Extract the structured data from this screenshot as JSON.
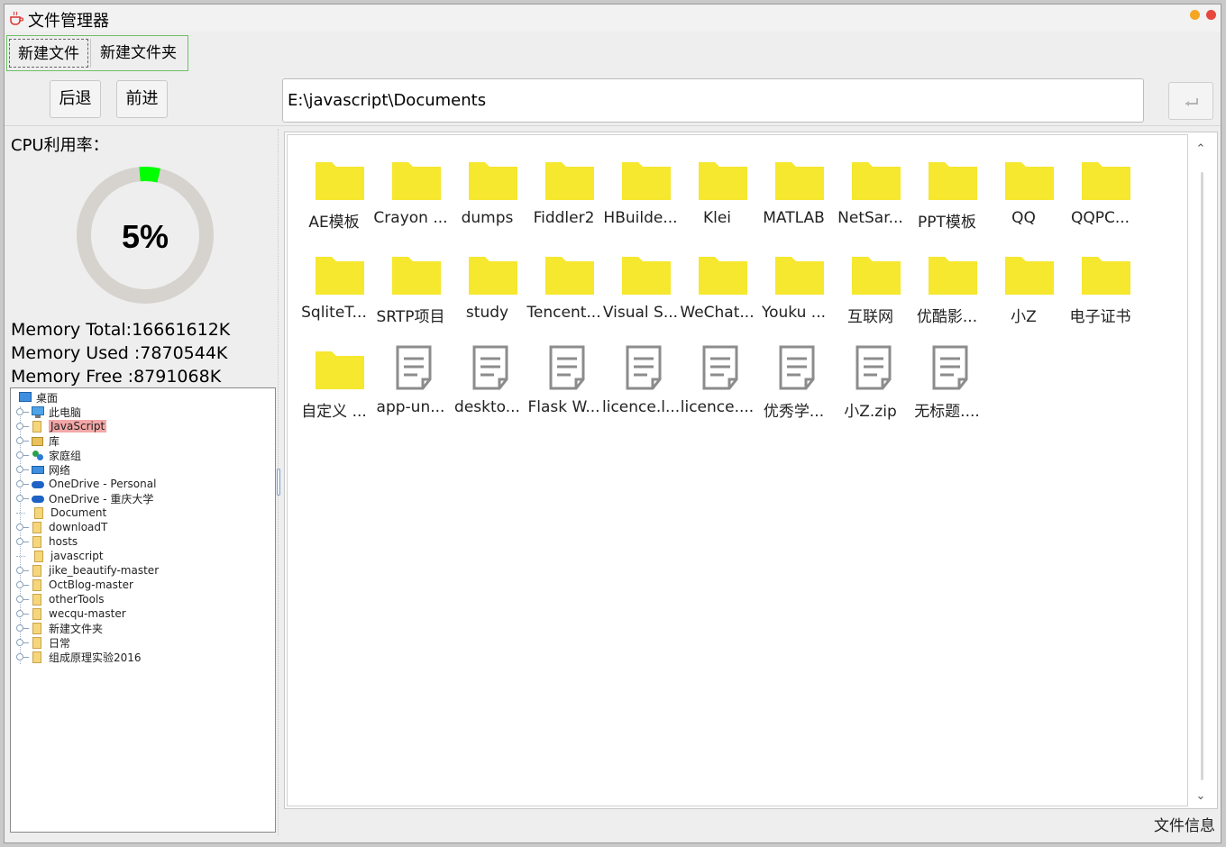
{
  "window": {
    "title": "文件管理器"
  },
  "toolbar": {
    "new_file": "新建文件",
    "new_folder": "新建文件夹"
  },
  "nav": {
    "back": "后退",
    "forward": "前进",
    "path": "E:\\javascript\\Documents"
  },
  "cpu": {
    "label": "CPU利用率：",
    "percent_text": "5%",
    "percent": 5,
    "ring_color": "#d6d3ce",
    "fill_color": "#00ff00"
  },
  "memory": {
    "total": "Memory Total:16661612K",
    "used": "Memory Used :7870544K",
    "free": "Memory Free :8791068K"
  },
  "tree": {
    "root": "桌面",
    "items": [
      {
        "label": "此电脑",
        "icon": "pc",
        "toggle": true,
        "selected": false
      },
      {
        "label": "JavaScript",
        "icon": "folder",
        "toggle": true,
        "selected": true
      },
      {
        "label": "库",
        "icon": "lib",
        "toggle": true,
        "selected": false
      },
      {
        "label": "家庭组",
        "icon": "group",
        "toggle": true,
        "selected": false
      },
      {
        "label": "网络",
        "icon": "net",
        "toggle": true,
        "selected": false
      },
      {
        "label": "OneDrive - Personal",
        "icon": "cloud",
        "toggle": true,
        "selected": false
      },
      {
        "label": "OneDrive - 重庆大学",
        "icon": "cloud",
        "toggle": true,
        "selected": false
      },
      {
        "label": "Document",
        "icon": "folder",
        "toggle": false,
        "selected": false
      },
      {
        "label": "downloadT",
        "icon": "folder",
        "toggle": true,
        "selected": false
      },
      {
        "label": "hosts",
        "icon": "folder",
        "toggle": true,
        "selected": false
      },
      {
        "label": "javascript",
        "icon": "folder",
        "toggle": false,
        "selected": false
      },
      {
        "label": "jike_beautify-master",
        "icon": "folder",
        "toggle": true,
        "selected": false
      },
      {
        "label": "OctBlog-master",
        "icon": "folder",
        "toggle": true,
        "selected": false
      },
      {
        "label": "otherTools",
        "icon": "folder",
        "toggle": true,
        "selected": false
      },
      {
        "label": "wecqu-master",
        "icon": "folder",
        "toggle": true,
        "selected": false
      },
      {
        "label": "新建文件夹",
        "icon": "folder",
        "toggle": true,
        "selected": false
      },
      {
        "label": "日常",
        "icon": "folder",
        "toggle": true,
        "selected": false
      },
      {
        "label": "组成原理实验2016",
        "icon": "folder",
        "toggle": true,
        "selected": false
      }
    ]
  },
  "files": [
    {
      "name": "AE模板",
      "type": "folder"
    },
    {
      "name": "Crayon ...",
      "type": "folder"
    },
    {
      "name": "dumps",
      "type": "folder"
    },
    {
      "name": "Fiddler2",
      "type": "folder"
    },
    {
      "name": "HBuilde...",
      "type": "folder"
    },
    {
      "name": "Klei",
      "type": "folder"
    },
    {
      "name": "MATLAB",
      "type": "folder"
    },
    {
      "name": "NetSar...",
      "type": "folder"
    },
    {
      "name": "PPT模板",
      "type": "folder"
    },
    {
      "name": "QQ",
      "type": "folder"
    },
    {
      "name": "QQPC...",
      "type": "folder"
    },
    {
      "name": "SqliteT...",
      "type": "folder"
    },
    {
      "name": "SRTP项目",
      "type": "folder"
    },
    {
      "name": "study",
      "type": "folder"
    },
    {
      "name": "Tencent...",
      "type": "folder"
    },
    {
      "name": "Visual S...",
      "type": "folder"
    },
    {
      "name": "WeChat...",
      "type": "folder"
    },
    {
      "name": "Youku ...",
      "type": "folder"
    },
    {
      "name": "互联网",
      "type": "folder"
    },
    {
      "name": "优酷影...",
      "type": "folder"
    },
    {
      "name": "小Z",
      "type": "folder"
    },
    {
      "name": "电子证书",
      "type": "folder"
    },
    {
      "name": "自定义 ...",
      "type": "folder"
    },
    {
      "name": "app-un...",
      "type": "file"
    },
    {
      "name": "deskto...",
      "type": "file"
    },
    {
      "name": "Flask W...",
      "type": "file"
    },
    {
      "name": "licence.l...",
      "type": "file"
    },
    {
      "name": "licence....",
      "type": "file"
    },
    {
      "name": "优秀学...",
      "type": "file"
    },
    {
      "name": "小Z.zip",
      "type": "file"
    },
    {
      "name": "无标题....",
      "type": "file"
    }
  ],
  "colors": {
    "folder": "#f6e72f",
    "file_icon": "#8c8c8c",
    "selection": "#f3a7a7",
    "toolbar_border": "#6cc164"
  },
  "status": {
    "label": "文件信息"
  }
}
